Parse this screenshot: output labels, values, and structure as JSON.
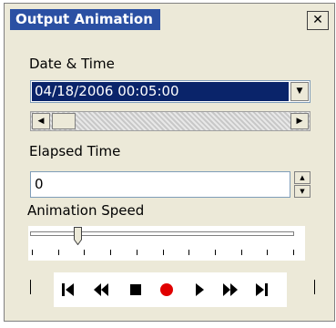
{
  "window": {
    "title": "Output Animation",
    "close_glyph": "✕"
  },
  "datetime": {
    "label": "Date & Time",
    "value": "04/18/2006 00:05:00",
    "dropdown_icon": "chevron-down-icon"
  },
  "scrollbar": {
    "left_icon": "arrow-left-icon",
    "right_icon": "arrow-right-icon"
  },
  "elapsed": {
    "label": "Elapsed Time",
    "value": "0"
  },
  "speed": {
    "label": "Animation Speed",
    "tick_count": 11,
    "level": 0.18
  },
  "controls": [
    {
      "name": "skip-to-start-button",
      "icon": "skip-start-icon"
    },
    {
      "name": "rewind-button",
      "icon": "rewind-icon"
    },
    {
      "name": "stop-button",
      "icon": "stop-icon"
    },
    {
      "name": "record-button",
      "icon": "record-icon",
      "color": "#e00000"
    },
    {
      "name": "play-button",
      "icon": "play-icon"
    },
    {
      "name": "fast-forward-button",
      "icon": "fast-forward-icon"
    },
    {
      "name": "skip-to-end-button",
      "icon": "skip-end-icon"
    }
  ]
}
